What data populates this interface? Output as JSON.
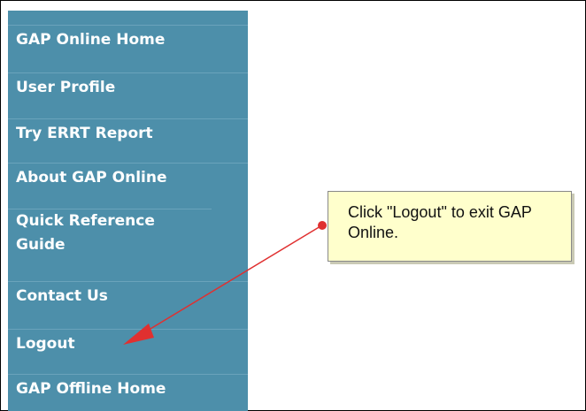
{
  "sidebar": {
    "items": [
      {
        "label": "GAP Online Home"
      },
      {
        "label": "User Profile"
      },
      {
        "label": "Try ERRT Report"
      },
      {
        "label": "About GAP Online"
      },
      {
        "label": "Quick Reference Guide"
      },
      {
        "label": "Contact Us"
      },
      {
        "label": "Logout"
      },
      {
        "label": "GAP Offline Home"
      }
    ]
  },
  "callout": {
    "text": "Click \"Logout\" to exit GAP Online."
  },
  "colors": {
    "sidebar_bg": "#4d8faa",
    "callout_bg": "#ffffcc",
    "arrow": "#e03030"
  }
}
